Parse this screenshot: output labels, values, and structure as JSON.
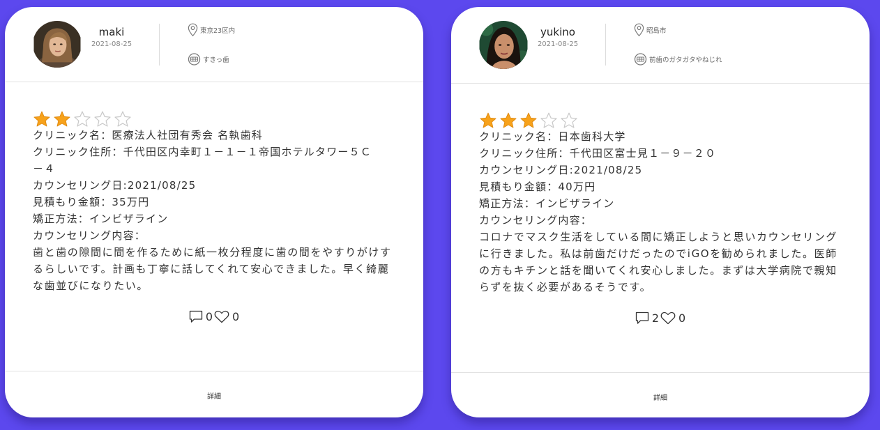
{
  "colors": {
    "page_background": "#5c48ee",
    "card_background": "#ffffff",
    "star_filled": "#f7a21b",
    "star_empty": "#c8c8c8"
  },
  "reviews": [
    {
      "username": "maki",
      "date": "2021-08-25",
      "location": "東京23区内",
      "concern": "すきっ歯",
      "rating": 2,
      "rating_max": 5,
      "lines": [
        "クリニック名：医療法人社団有秀会 名執歯科",
        "クリニック住所：千代田区内幸町１－１－１帝国ホテルタワー５Ｃ－４",
        "カウンセリング日:2021/08/25",
        "見積もり金額：35万円",
        "矯正方法：インビザライン",
        "カウンセリング内容："
      ],
      "comment": "歯と歯の隙間に間を作るために紙一枚分程度に歯の間をやすりがけするらしいです。計画も丁寧に話してくれて安心できました。早く綺麗な歯並びになりたい。",
      "comment_count": "0",
      "like_count": "0",
      "detail_label": "詳細"
    },
    {
      "username": "yukino",
      "date": "2021-08-25",
      "location": "昭島市",
      "concern": "前歯のガタガタやねじれ",
      "rating": 3,
      "rating_max": 5,
      "lines": [
        "クリニック名：日本歯科大学",
        "クリニック住所：千代田区富士見１－９－２０",
        "カウンセリング日:2021/08/25",
        "見積もり金額：40万円",
        "矯正方法：インビザライン",
        "カウンセリング内容："
      ],
      "comment": "コロナでマスク生活をしている間に矯正しようと思いカウンセリングに行きました。私は前歯だけだったのでiGOを勧められました。医師の方もキチンと話を聞いてくれ安心しました。まずは大学病院で親知らずを抜く必要があるそうです。",
      "comment_count": "2",
      "like_count": "0",
      "detail_label": "詳細"
    }
  ]
}
